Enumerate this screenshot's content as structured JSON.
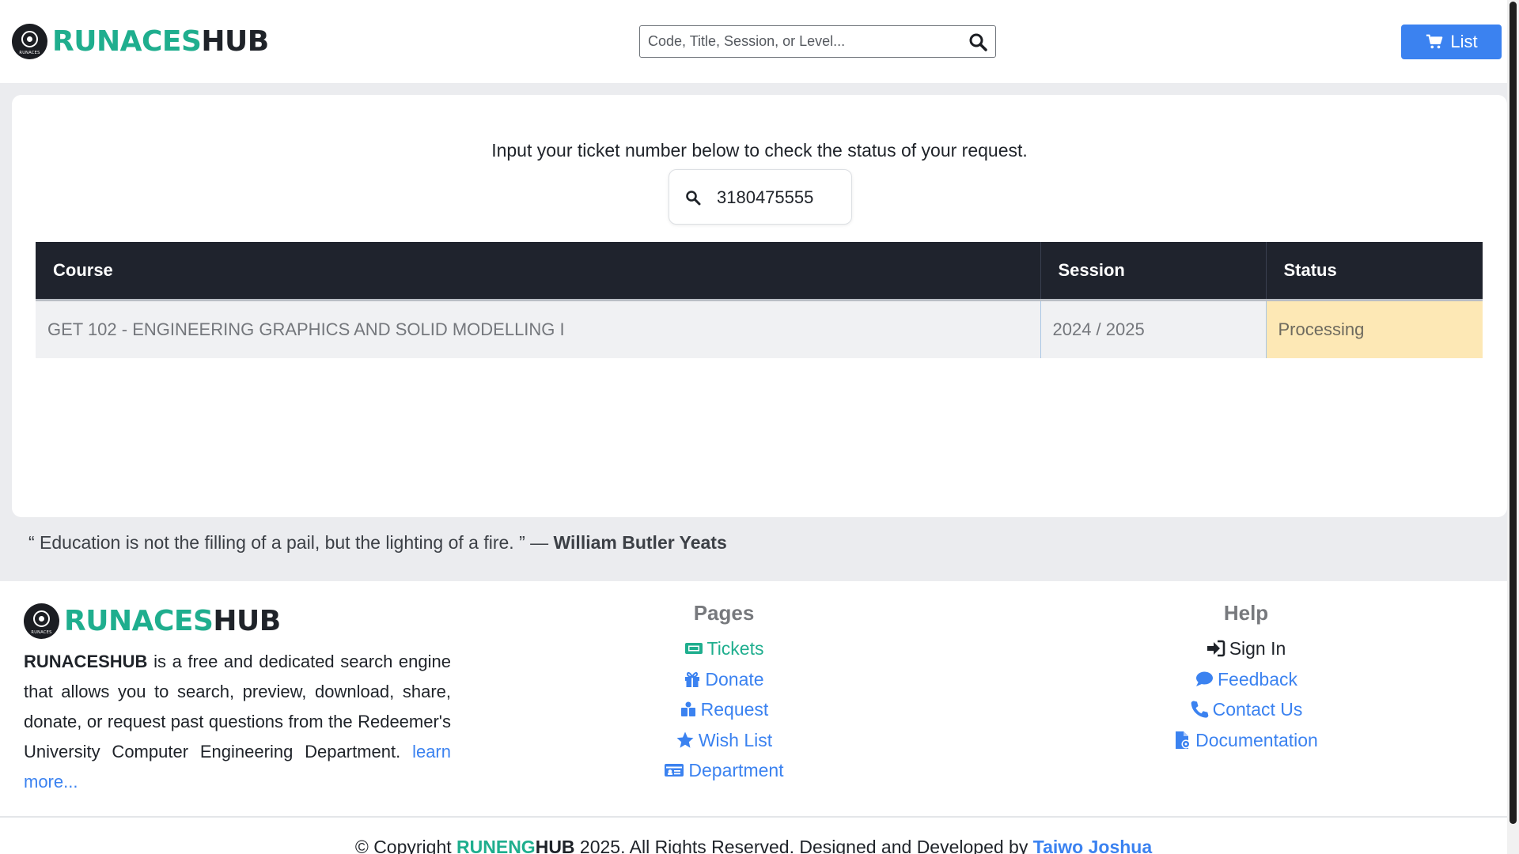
{
  "header": {
    "logo_part1": "RUNACES",
    "logo_part2": "HUB",
    "logo_badge_text": "RUNACES",
    "search_placeholder": "Code, Title, Session, or Level...",
    "list_button": "List"
  },
  "main": {
    "prompt": "Input your ticket number below to check the status of your request.",
    "ticket_value": "3180475555",
    "table": {
      "headers": [
        "Course",
        "Session",
        "Status"
      ],
      "rows": [
        {
          "course": "GET 102 - ENGINEERING GRAPHICS AND SOLID MODELLING I",
          "session": "2024 / 2025",
          "status": "Processing"
        }
      ]
    },
    "quote_text": "“ Education is not the filling of a pail, but the lighting of a fire. ” —",
    "quote_author": "William Butler Yeats"
  },
  "footer": {
    "brand_part1": "RUNACES",
    "brand_part2": "HUB",
    "desc_brand": "RUNACESHUB",
    "desc_text": " is a free and dedicated search engine that allows you to search, preview, download, share, donate, or request past questions from the Redeemer's University Computer Engineering Department. ",
    "learn_more": "learn more...",
    "pages_title": "Pages",
    "pages": [
      {
        "label": "Tickets",
        "icon": "ticket-icon"
      },
      {
        "label": "Donate",
        "icon": "gift-icon"
      },
      {
        "label": "Request",
        "icon": "hand-holding-icon"
      },
      {
        "label": "Wish List",
        "icon": "star-icon"
      },
      {
        "label": "Department",
        "icon": "id-card-icon"
      }
    ],
    "help_title": "Help",
    "help": [
      {
        "label": "Sign In",
        "icon": "sign-in-icon"
      },
      {
        "label": "Feedback",
        "icon": "comment-icon"
      },
      {
        "label": "Contact Us",
        "icon": "phone-icon"
      },
      {
        "label": "Documentation",
        "icon": "file-icon"
      }
    ],
    "copyright_prefix": "© Copyright ",
    "copyright_brand1": "RUNENG",
    "copyright_brand2": "HUB",
    "copyright_middle": " 2025. All Rights Reserved. Designed and Developed by ",
    "copyright_author": "Taiwo Joshua"
  },
  "colors": {
    "brand_green": "#1fae8e",
    "link_blue": "#3b82f0",
    "table_header": "#1f232d",
    "status_processing": "#fde8b5"
  }
}
